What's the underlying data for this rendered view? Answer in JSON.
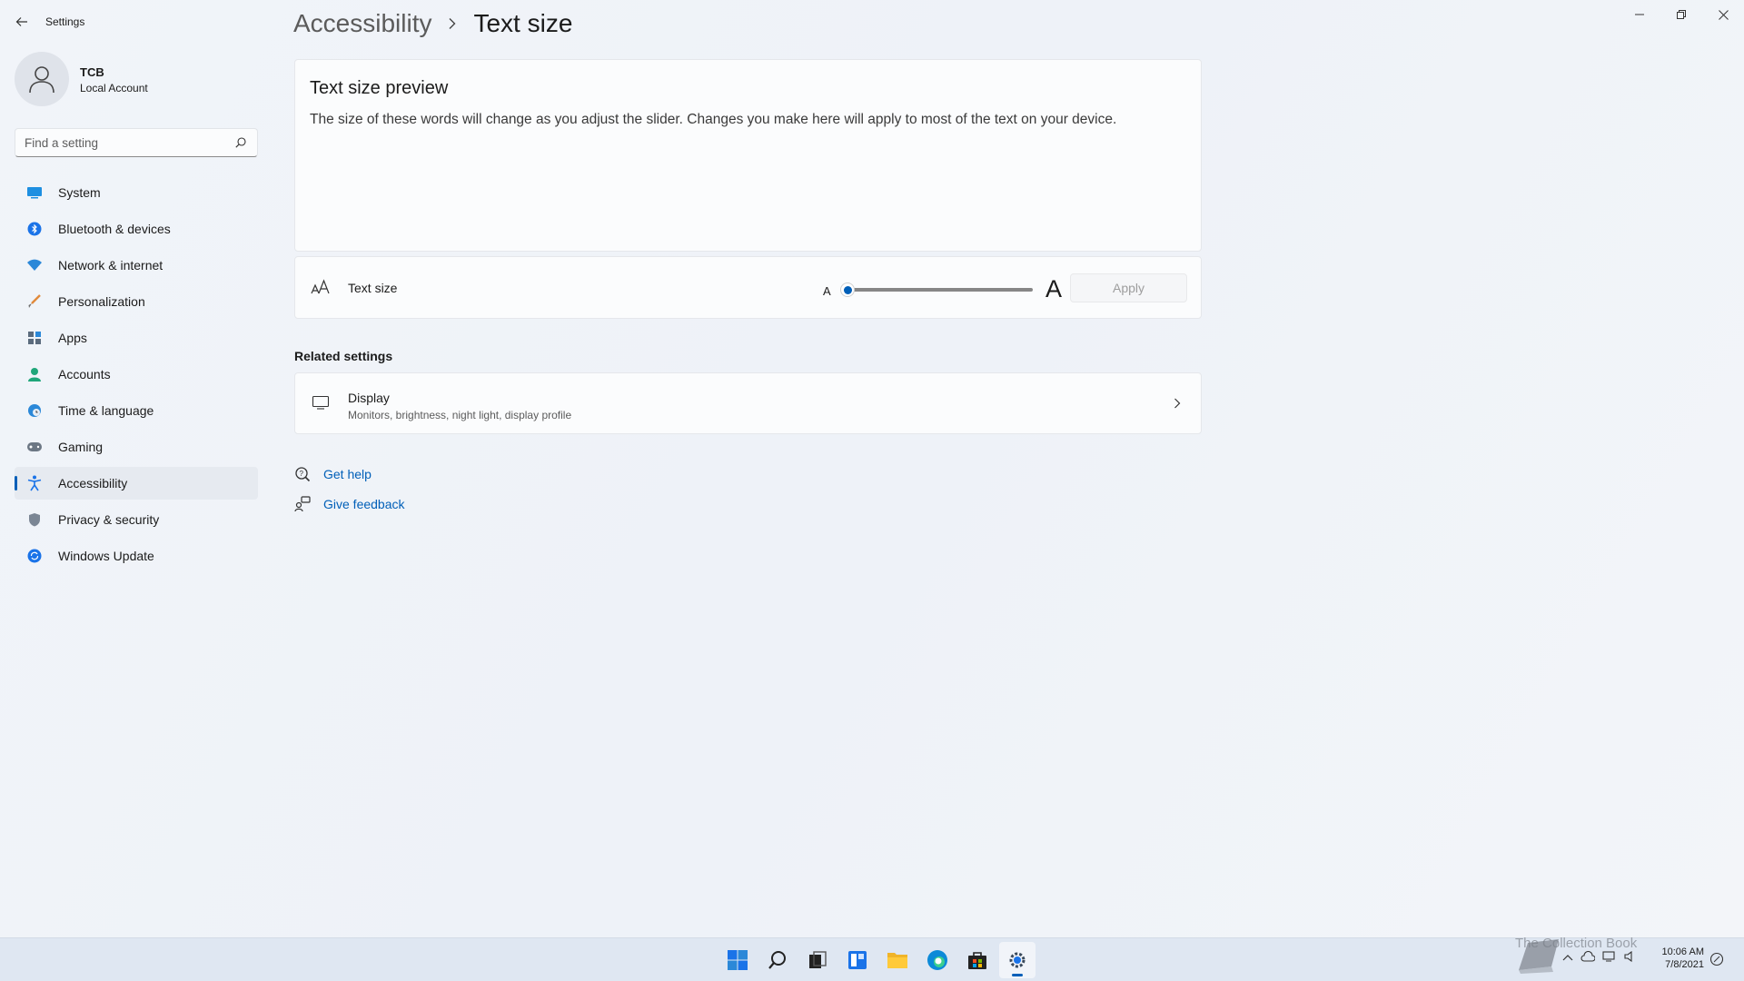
{
  "window": {
    "app_title": "Settings",
    "controls": [
      "minimize",
      "restore",
      "close"
    ]
  },
  "account": {
    "name": "TCB",
    "type": "Local Account"
  },
  "search": {
    "placeholder": "Find a setting"
  },
  "sidebar": {
    "items": [
      {
        "label": "System",
        "icon": "system-icon"
      },
      {
        "label": "Bluetooth & devices",
        "icon": "bluetooth-icon"
      },
      {
        "label": "Network & internet",
        "icon": "wifi-icon"
      },
      {
        "label": "Personalization",
        "icon": "brush-icon"
      },
      {
        "label": "Apps",
        "icon": "apps-icon"
      },
      {
        "label": "Accounts",
        "icon": "accounts-icon"
      },
      {
        "label": "Time & language",
        "icon": "globe-clock-icon"
      },
      {
        "label": "Gaming",
        "icon": "controller-icon"
      },
      {
        "label": "Accessibility",
        "icon": "accessibility-icon",
        "active": true
      },
      {
        "label": "Privacy & security",
        "icon": "shield-icon"
      },
      {
        "label": "Windows Update",
        "icon": "update-icon"
      }
    ]
  },
  "header": {
    "parent": "Accessibility",
    "current": "Text size"
  },
  "preview": {
    "title": "Text size preview",
    "text": "The size of these words will change as you adjust the slider. Changes you make here will apply to most of the text on your device."
  },
  "text_size": {
    "label": "Text size",
    "small_a": "A",
    "big_a": "A",
    "slider_value": 0,
    "apply_label": "Apply"
  },
  "related": {
    "title": "Related settings",
    "display_title": "Display",
    "display_subtitle": "Monitors, brightness, night light, display profile"
  },
  "help": {
    "get_help": "Get help",
    "give_feedback": "Give feedback"
  },
  "taskbar": {
    "apps": [
      "start-icon",
      "search-icon",
      "task-view-icon",
      "widgets-icon",
      "file-explorer-icon",
      "edge-icon",
      "store-icon",
      "settings-icon"
    ],
    "active_app": "settings-icon",
    "watermark": "The Collection Book",
    "clock_time": "10:06 AM",
    "clock_date": "7/8/2021"
  },
  "colors": {
    "accent": "#005fb8",
    "background": "#eef2f8"
  }
}
